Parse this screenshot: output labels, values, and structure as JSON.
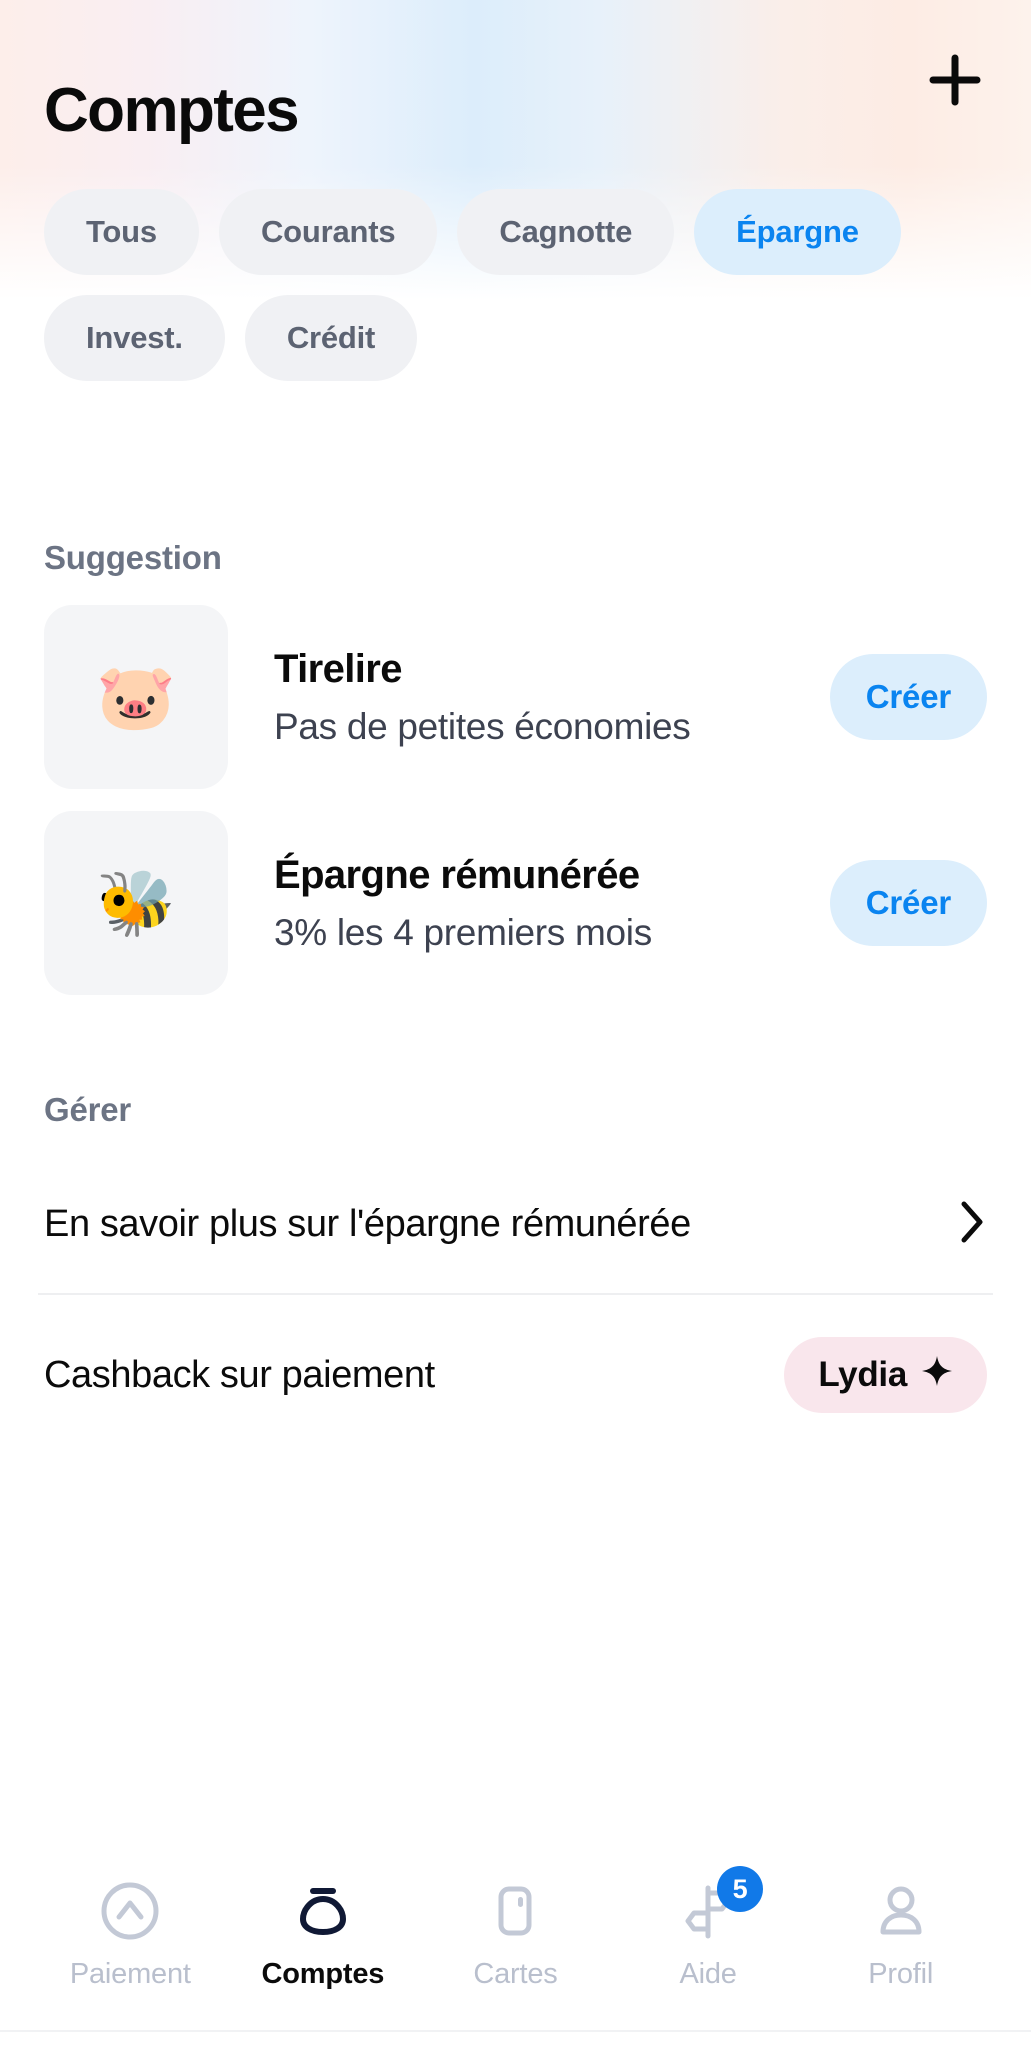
{
  "header": {
    "title": "Comptes",
    "add_icon": "plus-icon"
  },
  "filters": {
    "chips": [
      {
        "label": "Tous",
        "selected": false
      },
      {
        "label": "Courants",
        "selected": false
      },
      {
        "label": "Cagnotte",
        "selected": false
      },
      {
        "label": "Épargne",
        "selected": true
      },
      {
        "label": "Invest.",
        "selected": false
      },
      {
        "label": "Crédit",
        "selected": false
      }
    ],
    "selected_color": "#0a84f0",
    "selected_bg": "#dceefc",
    "idle_bg": "#f0f1f4",
    "idle_color": "#5c6372"
  },
  "suggestion": {
    "section_title": "Suggestion",
    "items": [
      {
        "emoji": "🐷",
        "emoji_name": "pig-emoji",
        "title": "Tirelire",
        "subtitle": "Pas de petites économies",
        "action_label": "Créer"
      },
      {
        "emoji": "🐝",
        "emoji_name": "bee-emoji",
        "title": "Épargne rémunérée",
        "subtitle": "3% les 4 premiers mois",
        "action_label": "Créer"
      }
    ]
  },
  "gerer": {
    "section_title": "Gérer",
    "rows": [
      {
        "label": "En savoir plus sur l'épargne rémunérée",
        "accessory": "chevron-right-icon"
      },
      {
        "label": "Cashback sur paiement",
        "accessory": "lydia-badge",
        "badge_label": "Lydia",
        "badge_icon": "sparkle-icon",
        "badge_bg": "#f9e6ec"
      }
    ]
  },
  "tabbar": {
    "items": [
      {
        "label": "Paiement",
        "icon": "payment-circle-icon",
        "active": false,
        "badge": null
      },
      {
        "label": "Comptes",
        "icon": "piggy-bank-icon",
        "active": true,
        "badge": null
      },
      {
        "label": "Cartes",
        "icon": "card-icon",
        "active": false,
        "badge": null
      },
      {
        "label": "Aide",
        "icon": "signpost-icon",
        "active": false,
        "badge": "5"
      },
      {
        "label": "Profil",
        "icon": "person-icon",
        "active": false,
        "badge": null
      }
    ],
    "badge_color": "#1179e8",
    "active_color": "#0b0b0b",
    "idle_color": "#b9bfcd"
  }
}
